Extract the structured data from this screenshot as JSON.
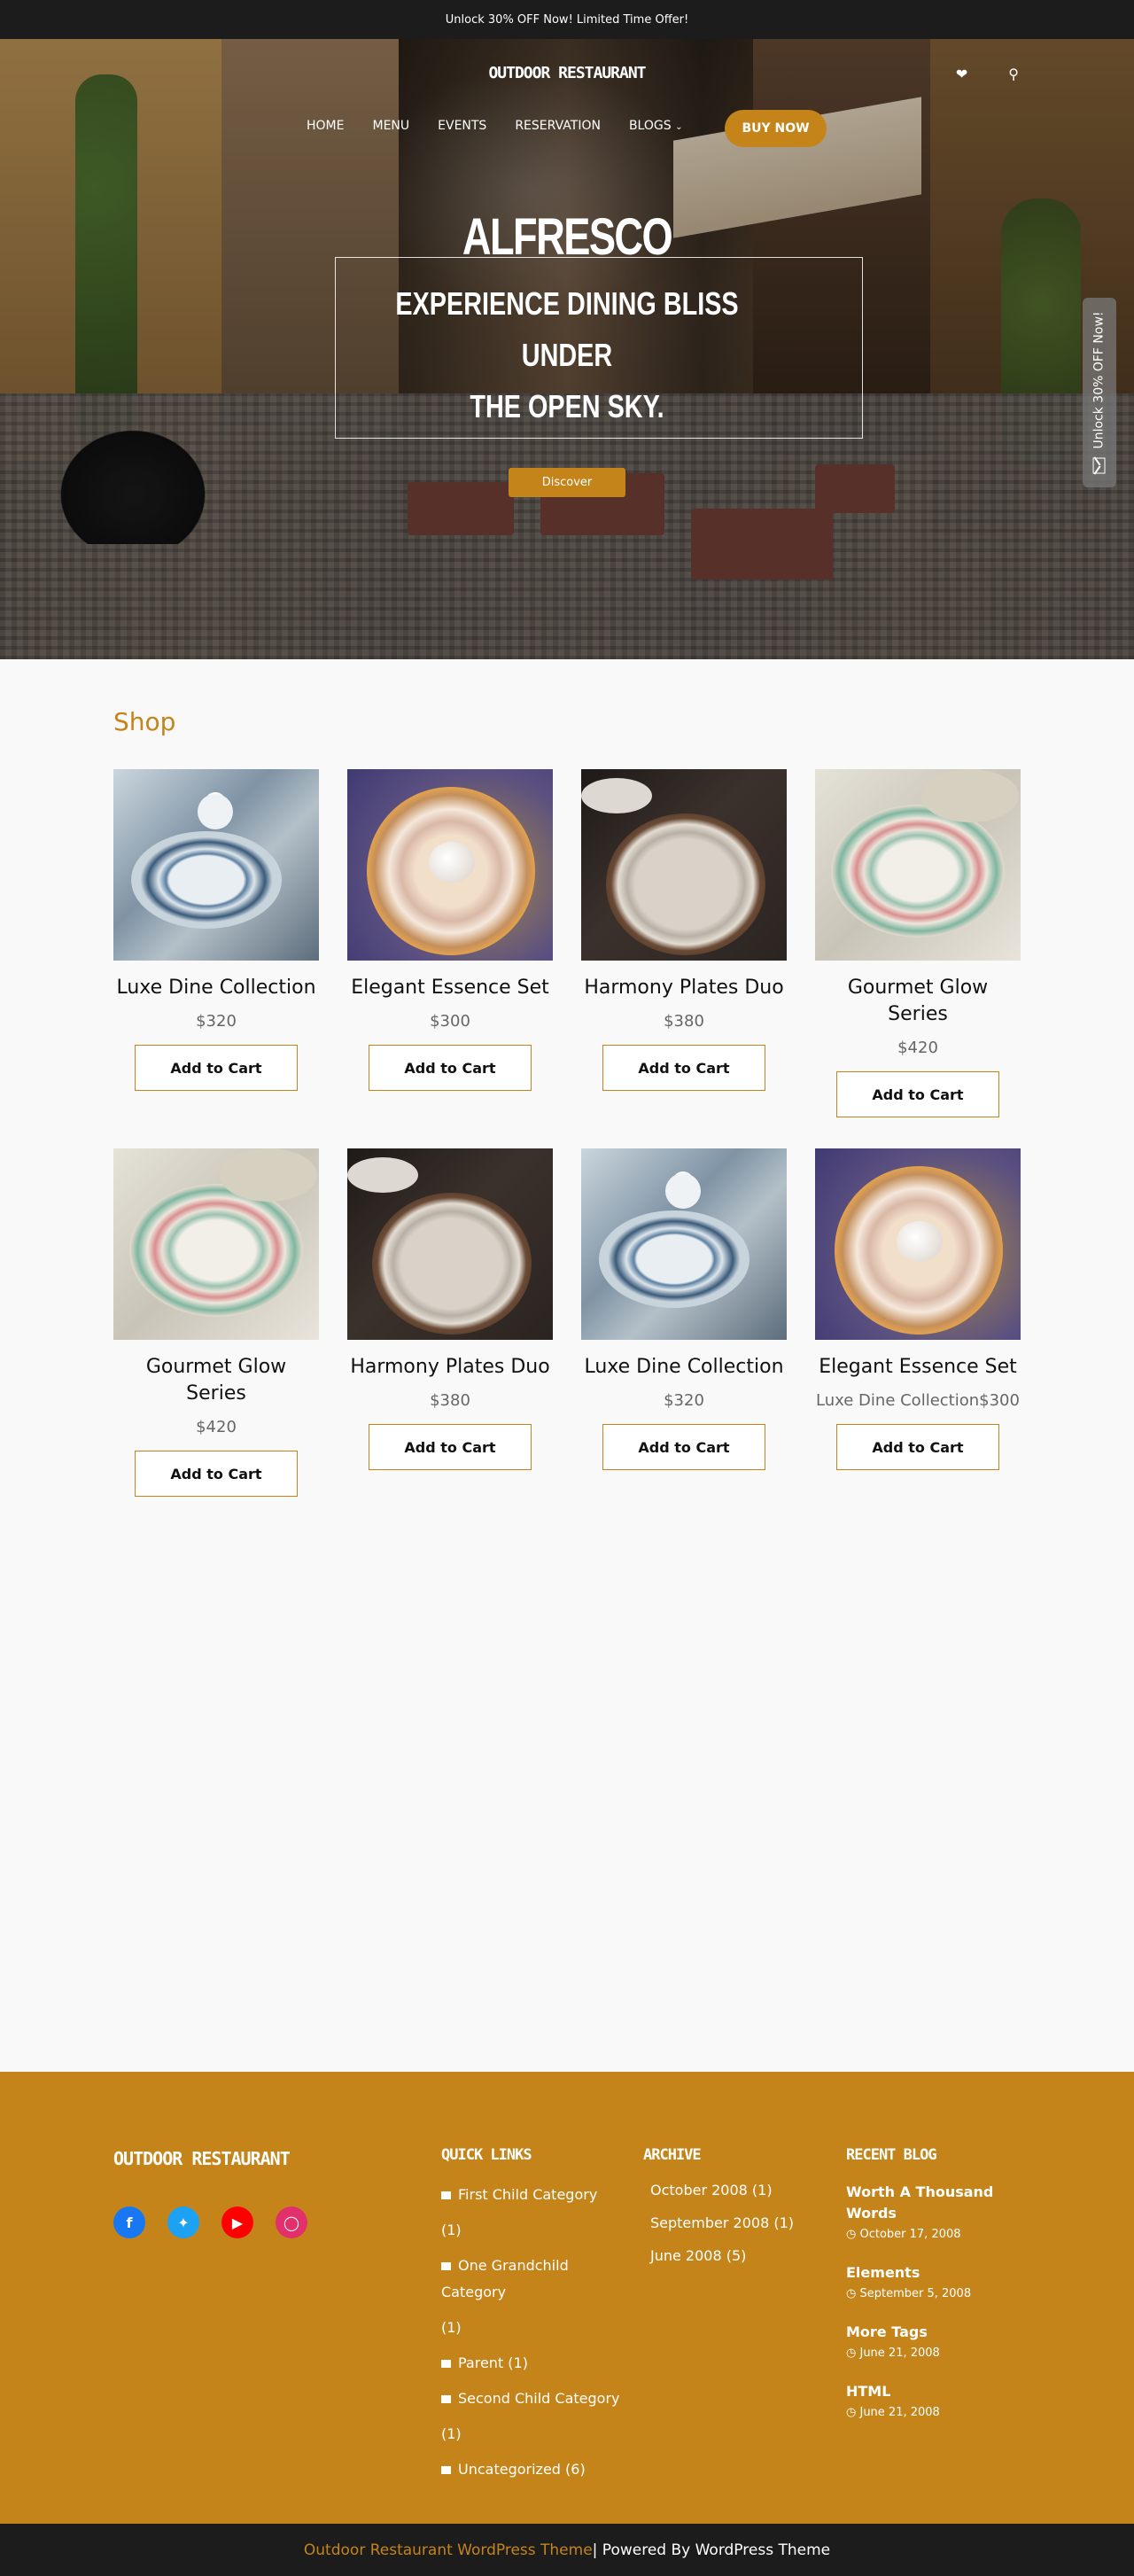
{
  "topbar": {
    "text": "Unlock 30% OFF Now! Limited Time Offer!"
  },
  "header": {
    "logo": "OUTDOOR RESTAURANT",
    "nav": [
      "HOME",
      "MENU",
      "EVENTS",
      "RESERVATION",
      "BLOGS"
    ],
    "buy_label": "BUY NOW",
    "icons": [
      "heart-icon",
      "search-icon"
    ]
  },
  "hero": {
    "title": "ALFRESCO",
    "subtitle_line1": "EXPERIENCE DINING BLISS",
    "subtitle_line2": "UNDER",
    "subtitle_line3": "THE OPEN SKY.",
    "button": "Discover",
    "sidetab": "Unlock 30% OFF Now!"
  },
  "shop": {
    "title": "Shop",
    "cart_label": "Add to Cart",
    "products": [
      {
        "name": "Luxe Dine Collection",
        "price": "$320"
      },
      {
        "name": "Elegant Essence Set",
        "price": "$300"
      },
      {
        "name": "Harmony Plates Duo",
        "price": "$380"
      },
      {
        "name": "Gourmet Glow Series",
        "price": "$420"
      },
      {
        "name": "Gourmet Glow Series",
        "price": "$420"
      },
      {
        "name": "Harmony Plates Duo",
        "price": "$380"
      },
      {
        "name": "Luxe Dine Collection",
        "price": "$320"
      },
      {
        "name": "Elegant Essence Set",
        "price": "Luxe Dine Collection$300"
      }
    ]
  },
  "footer": {
    "logo": "OUTDOOR RESTAURANT",
    "social": [
      "facebook-icon",
      "twitter-icon",
      "youtube-icon",
      "instagram-icon"
    ],
    "social_colors": [
      "#1877f2",
      "#1da1f2",
      "#ff0000",
      "#e1306c"
    ],
    "quick_links_title": "QUICK LINKS",
    "quick_links": [
      "First Child Category",
      "(1)",
      "One Grandchild Category",
      "(1)",
      "Parent (1)",
      "Second Child Category",
      "(1)",
      "Uncategorized (6)"
    ],
    "archive_title": "ARCHIVE",
    "archive": [
      "October 2008 (1)",
      "September 2008 (1)",
      "June 2008 (5)"
    ],
    "recent_title": "RECENT BLOG",
    "recent": [
      {
        "title": "Worth A Thousand Words",
        "date": "October 17, 2008"
      },
      {
        "title": "Elements",
        "date": "September 5, 2008"
      },
      {
        "title": "More Tags",
        "date": "June 21, 2008"
      },
      {
        "title": "HTML",
        "date": "June 21, 2008"
      }
    ]
  },
  "bottom": {
    "theme_link": "Outdoor Restaurant WordPress Theme",
    "powered": " | Powered By WordPress Theme"
  },
  "colors": {
    "accent": "#c4841a",
    "dark": "#1c1c1c"
  }
}
